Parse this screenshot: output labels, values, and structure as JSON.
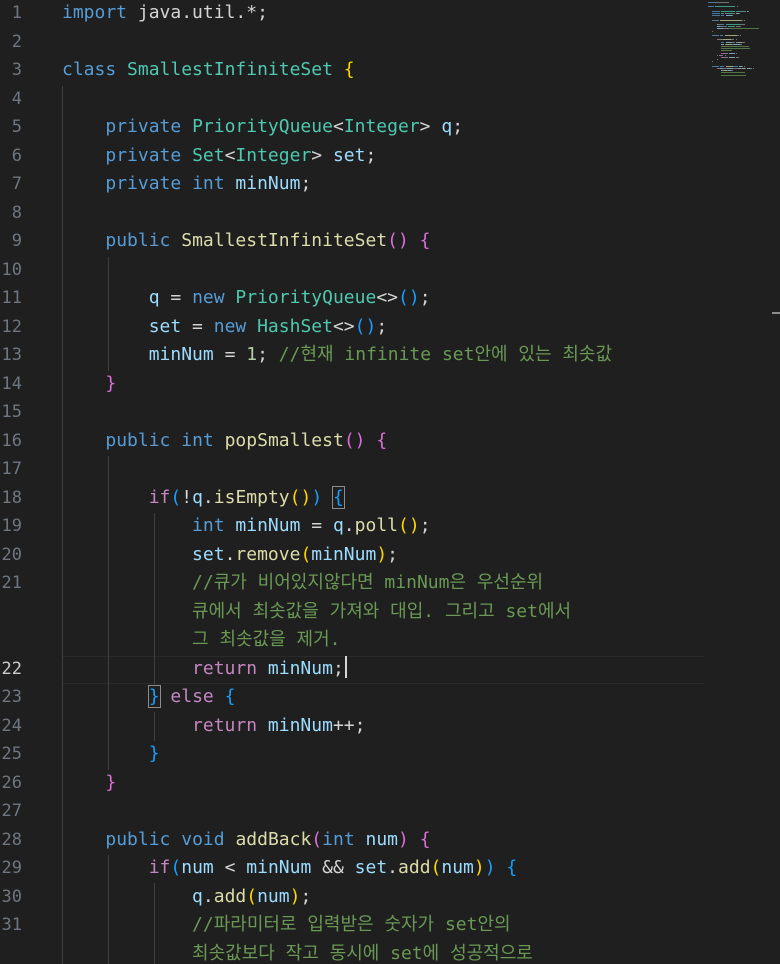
{
  "editor": {
    "language": "java",
    "active_line": 22,
    "colors": {
      "background": "#1f1f1f",
      "keyword": "#569cd6",
      "control": "#c586c0",
      "type": "#4ec9b0",
      "variable": "#9cdcfe",
      "function": "#dcdcaa",
      "number": "#b5cea8",
      "comment": "#6a9955",
      "bracket_1": "#ffd700",
      "bracket_2": "#da70d6",
      "bracket_3": "#179fff"
    },
    "line_numbers": [
      "1",
      "2",
      "3",
      "4",
      "5",
      "6",
      "7",
      "8",
      "9",
      "10",
      "11",
      "12",
      "13",
      "14",
      "15",
      "16",
      "17",
      "18",
      "19",
      "20",
      "21",
      "",
      "",
      "22",
      "23",
      "24",
      "25",
      "26",
      "27",
      "28",
      "29",
      "30",
      "31",
      ""
    ],
    "lines": [
      [
        {
          "c": "kw",
          "t": "import"
        },
        {
          "c": "",
          "t": " java.util.*;"
        }
      ],
      [],
      [
        {
          "c": "kw",
          "t": "class"
        },
        {
          "c": "",
          "t": " "
        },
        {
          "c": "ty",
          "t": "SmallestInfiniteSet"
        },
        {
          "c": "",
          "t": " "
        },
        {
          "c": "b1",
          "t": "{"
        }
      ],
      [],
      [
        {
          "c": "",
          "t": "    "
        },
        {
          "c": "kw",
          "t": "private"
        },
        {
          "c": "",
          "t": " "
        },
        {
          "c": "ty",
          "t": "PriorityQueue"
        },
        {
          "c": "",
          "t": "<"
        },
        {
          "c": "ty",
          "t": "Integer"
        },
        {
          "c": "",
          "t": "> "
        },
        {
          "c": "vr",
          "t": "q"
        },
        {
          "c": "",
          "t": ";"
        }
      ],
      [
        {
          "c": "",
          "t": "    "
        },
        {
          "c": "kw",
          "t": "private"
        },
        {
          "c": "",
          "t": " "
        },
        {
          "c": "ty",
          "t": "Set"
        },
        {
          "c": "",
          "t": "<"
        },
        {
          "c": "ty",
          "t": "Integer"
        },
        {
          "c": "",
          "t": "> "
        },
        {
          "c": "vr",
          "t": "set"
        },
        {
          "c": "",
          "t": ";"
        }
      ],
      [
        {
          "c": "",
          "t": "    "
        },
        {
          "c": "kw",
          "t": "private"
        },
        {
          "c": "",
          "t": " "
        },
        {
          "c": "kw",
          "t": "int"
        },
        {
          "c": "",
          "t": " "
        },
        {
          "c": "vr",
          "t": "minNum"
        },
        {
          "c": "",
          "t": ";"
        }
      ],
      [],
      [
        {
          "c": "",
          "t": "    "
        },
        {
          "c": "kw",
          "t": "public"
        },
        {
          "c": "",
          "t": " "
        },
        {
          "c": "fn",
          "t": "SmallestInfiniteSet"
        },
        {
          "c": "b2",
          "t": "()"
        },
        {
          "c": "",
          "t": " "
        },
        {
          "c": "b2",
          "t": "{"
        }
      ],
      [],
      [
        {
          "c": "",
          "t": "        "
        },
        {
          "c": "vr",
          "t": "q"
        },
        {
          "c": "",
          "t": " = "
        },
        {
          "c": "kw",
          "t": "new"
        },
        {
          "c": "",
          "t": " "
        },
        {
          "c": "ty",
          "t": "PriorityQueue"
        },
        {
          "c": "",
          "t": "<>"
        },
        {
          "c": "b3",
          "t": "()"
        },
        {
          "c": "",
          "t": ";"
        }
      ],
      [
        {
          "c": "",
          "t": "        "
        },
        {
          "c": "vr",
          "t": "set"
        },
        {
          "c": "",
          "t": " = "
        },
        {
          "c": "kw",
          "t": "new"
        },
        {
          "c": "",
          "t": " "
        },
        {
          "c": "ty",
          "t": "HashSet"
        },
        {
          "c": "",
          "t": "<>"
        },
        {
          "c": "b3",
          "t": "()"
        },
        {
          "c": "",
          "t": ";"
        }
      ],
      [
        {
          "c": "",
          "t": "        "
        },
        {
          "c": "vr",
          "t": "minNum"
        },
        {
          "c": "",
          "t": " = "
        },
        {
          "c": "nm",
          "t": "1"
        },
        {
          "c": "",
          "t": "; "
        },
        {
          "c": "cm",
          "t": "//현재 infinite set안에 있는 최솟값"
        }
      ],
      [
        {
          "c": "",
          "t": "    "
        },
        {
          "c": "b2",
          "t": "}"
        }
      ],
      [],
      [
        {
          "c": "",
          "t": "    "
        },
        {
          "c": "kw",
          "t": "public"
        },
        {
          "c": "",
          "t": " "
        },
        {
          "c": "kw",
          "t": "int"
        },
        {
          "c": "",
          "t": " "
        },
        {
          "c": "fn",
          "t": "popSmallest"
        },
        {
          "c": "b2",
          "t": "()"
        },
        {
          "c": "",
          "t": " "
        },
        {
          "c": "b2",
          "t": "{"
        }
      ],
      [],
      [
        {
          "c": "",
          "t": "        "
        },
        {
          "c": "ctl",
          "t": "if"
        },
        {
          "c": "b3",
          "t": "("
        },
        {
          "c": "",
          "t": "!"
        },
        {
          "c": "vr",
          "t": "q"
        },
        {
          "c": "",
          "t": "."
        },
        {
          "c": "fn",
          "t": "isEmpty"
        },
        {
          "c": "b1",
          "t": "()"
        },
        {
          "c": "b3",
          "t": ")"
        },
        {
          "c": "",
          "t": " "
        },
        {
          "c": "b3 bm-box",
          "t": "{"
        }
      ],
      [
        {
          "c": "",
          "t": "            "
        },
        {
          "c": "kw",
          "t": "int"
        },
        {
          "c": "",
          "t": " "
        },
        {
          "c": "vr",
          "t": "minNum"
        },
        {
          "c": "",
          "t": " = "
        },
        {
          "c": "vr",
          "t": "q"
        },
        {
          "c": "",
          "t": "."
        },
        {
          "c": "fn",
          "t": "poll"
        },
        {
          "c": "b1",
          "t": "()"
        },
        {
          "c": "",
          "t": ";"
        }
      ],
      [
        {
          "c": "",
          "t": "            "
        },
        {
          "c": "vr",
          "t": "set"
        },
        {
          "c": "",
          "t": "."
        },
        {
          "c": "fn",
          "t": "remove"
        },
        {
          "c": "b1",
          "t": "("
        },
        {
          "c": "vr",
          "t": "minNum"
        },
        {
          "c": "b1",
          "t": ")"
        },
        {
          "c": "",
          "t": ";"
        }
      ],
      [
        {
          "c": "",
          "t": "            "
        },
        {
          "c": "cm",
          "t": "//큐가 비어있지않다면 minNum은 우선순위"
        }
      ],
      [
        {
          "c": "",
          "t": "            "
        },
        {
          "c": "cm",
          "t": "큐에서 최솟값을 가져와 대입. 그리고 set에서"
        }
      ],
      [
        {
          "c": "",
          "t": "            "
        },
        {
          "c": "cm",
          "t": "그 최솟값을 제거."
        }
      ],
      [
        {
          "c": "",
          "t": "            "
        },
        {
          "c": "ctl",
          "t": "return"
        },
        {
          "c": "",
          "t": " "
        },
        {
          "c": "vr",
          "t": "minNum"
        },
        {
          "c": "",
          "t": ";"
        },
        {
          "c": "cursor",
          "t": ""
        }
      ],
      [
        {
          "c": "",
          "t": "        "
        },
        {
          "c": "b3 bm-box",
          "t": "}"
        },
        {
          "c": "",
          "t": " "
        },
        {
          "c": "ctl",
          "t": "else"
        },
        {
          "c": "",
          "t": " "
        },
        {
          "c": "b3",
          "t": "{"
        }
      ],
      [
        {
          "c": "",
          "t": "            "
        },
        {
          "c": "ctl",
          "t": "return"
        },
        {
          "c": "",
          "t": " "
        },
        {
          "c": "vr",
          "t": "minNum"
        },
        {
          "c": "",
          "t": "++;"
        }
      ],
      [
        {
          "c": "",
          "t": "        "
        },
        {
          "c": "b3",
          "t": "}"
        }
      ],
      [
        {
          "c": "",
          "t": "    "
        },
        {
          "c": "b2",
          "t": "}"
        }
      ],
      [],
      [
        {
          "c": "",
          "t": "    "
        },
        {
          "c": "kw",
          "t": "public"
        },
        {
          "c": "",
          "t": " "
        },
        {
          "c": "kw",
          "t": "void"
        },
        {
          "c": "",
          "t": " "
        },
        {
          "c": "fn",
          "t": "addBack"
        },
        {
          "c": "b2",
          "t": "("
        },
        {
          "c": "kw",
          "t": "int"
        },
        {
          "c": "",
          "t": " "
        },
        {
          "c": "vr",
          "t": "num"
        },
        {
          "c": "b2",
          "t": ")"
        },
        {
          "c": "",
          "t": " "
        },
        {
          "c": "b2",
          "t": "{"
        }
      ],
      [
        {
          "c": "",
          "t": "        "
        },
        {
          "c": "ctl",
          "t": "if"
        },
        {
          "c": "b3",
          "t": "("
        },
        {
          "c": "vr",
          "t": "num"
        },
        {
          "c": "",
          "t": " < "
        },
        {
          "c": "vr",
          "t": "minNum"
        },
        {
          "c": "",
          "t": " && "
        },
        {
          "c": "vr",
          "t": "set"
        },
        {
          "c": "",
          "t": "."
        },
        {
          "c": "fn",
          "t": "add"
        },
        {
          "c": "b1",
          "t": "("
        },
        {
          "c": "vr",
          "t": "num"
        },
        {
          "c": "b1",
          "t": ")"
        },
        {
          "c": "b3",
          "t": ")"
        },
        {
          "c": "",
          "t": " "
        },
        {
          "c": "b3",
          "t": "{"
        }
      ],
      [
        {
          "c": "",
          "t": "            "
        },
        {
          "c": "vr",
          "t": "q"
        },
        {
          "c": "",
          "t": "."
        },
        {
          "c": "fn",
          "t": "add"
        },
        {
          "c": "b1",
          "t": "("
        },
        {
          "c": "vr",
          "t": "num"
        },
        {
          "c": "b1",
          "t": ")"
        },
        {
          "c": "",
          "t": ";"
        }
      ],
      [
        {
          "c": "",
          "t": "            "
        },
        {
          "c": "cm",
          "t": "//파라미터로 입력받은 숫자가 set안의"
        }
      ],
      [
        {
          "c": "",
          "t": "            "
        },
        {
          "c": "cm",
          "t": "최솟값보다 작고 동시에 set에 성공적으로"
        }
      ]
    ]
  }
}
